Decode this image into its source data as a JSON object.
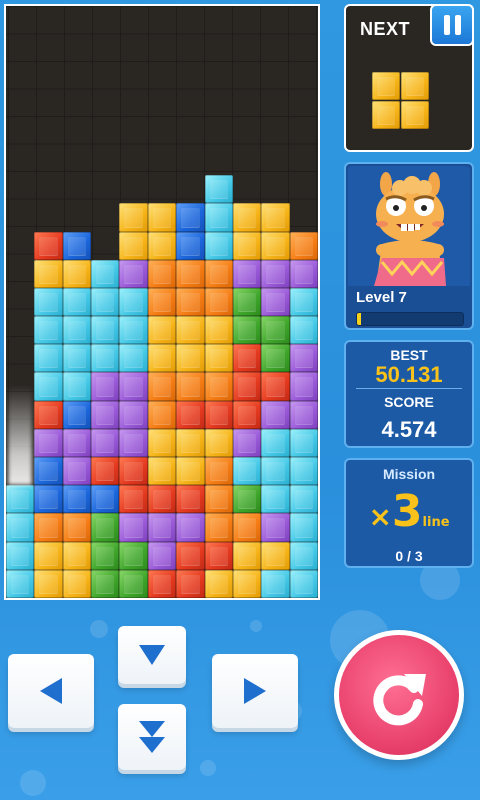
{
  "next": {
    "label": "NEXT",
    "piece": "O-yellow"
  },
  "pause": {
    "icon": "pause-icon"
  },
  "level": {
    "label": "Level",
    "value": "7",
    "progress_fraction": 0.04
  },
  "scores": {
    "best_label": "BEST",
    "best_value": "50.131",
    "score_label": "SCORE",
    "score_value": "4.574"
  },
  "mission": {
    "label": "Mission",
    "multiplier": "×",
    "count": "3",
    "unit": "line",
    "progress": "0 / 3"
  },
  "controls": {
    "left_icon": "triangle-left-icon",
    "down_icon": "triangle-down-icon",
    "drop_icon": "double-triangle-down-icon",
    "right_icon": "triangle-right-icon",
    "rotate_icon": "rotate-clockwise-icon"
  },
  "colors": {
    "Y": "#f6b418",
    "C": "#45c8e6",
    "B": "#1b65db",
    "R": "#e4391f",
    "P": "#9a5ad8",
    "O": "#f57c14",
    "G": "#3ea52a",
    "accent": "#e8416c",
    "gold": "#f8c21a"
  },
  "board": {
    "cols": 11,
    "rows": 21,
    "grid": [
      "...........",
      "...........",
      "...........",
      "...........",
      "...........",
      "...........",
      ".......C...",
      "....YYBCYY.",
      ".RB.YYBCYYO",
      ".YYCPOOOPPP",
      ".CCCCOOOGPC",
      ".CCCCYYYGGC",
      ".CCCCYYYRGP",
      ".CCPPOOORRP",
      ".RBPPORRRPP",
      ".PPPPYYYPCC",
      ".BPRRYYOCCC",
      "CBBBRRROGCC",
      "COOGPPPOOPC",
      "CYYGGPRRYYC",
      "CYYGGRRYYCC"
    ]
  }
}
